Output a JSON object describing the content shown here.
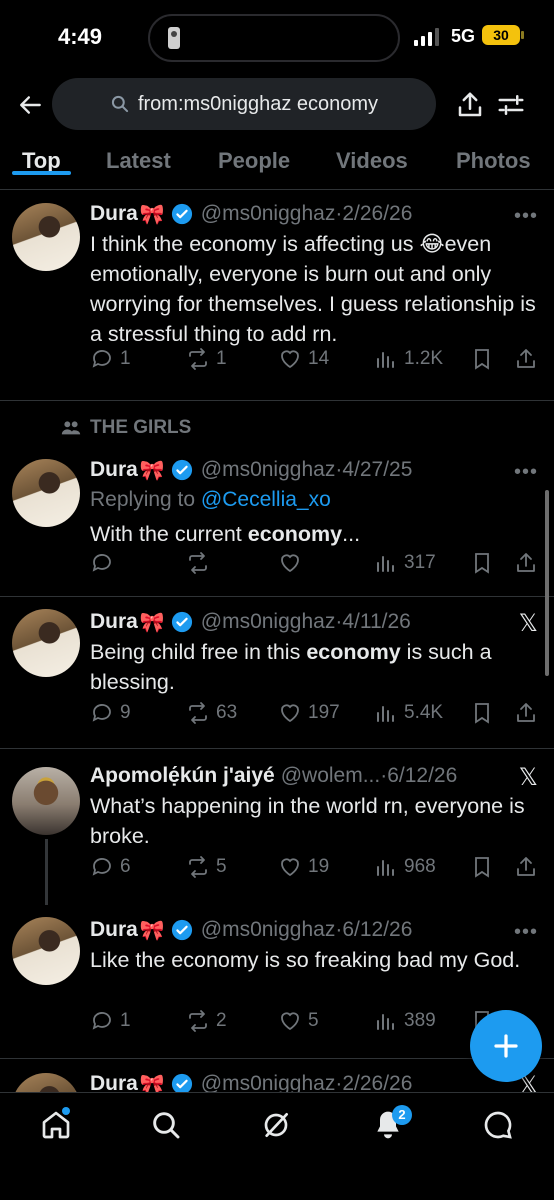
{
  "status_bar": {
    "time": "4:49",
    "network": "5G",
    "battery": "30"
  },
  "search": {
    "query": "from:ms0nigghaz economy"
  },
  "tabs": [
    {
      "label": "Top"
    },
    {
      "label": "Latest"
    },
    {
      "label": "People"
    },
    {
      "label": "Videos"
    },
    {
      "label": "Photos"
    }
  ],
  "colors": {
    "accent": "#1d9bf0",
    "muted": "#71767b",
    "background": "#000000"
  },
  "posts": [
    {
      "name": "Dura",
      "emoji": "🎀",
      "handle": "@ms0nigghaz",
      "date": "·2/26/26",
      "text_parts": [
        "I think the economy is affecting us 😂even emotionally, everyone is burn out and only worrying for themselves. I guess relationship is a stressful thing to add rn."
      ],
      "replies": "1",
      "reposts": "1",
      "likes": "14",
      "views": "1.2K"
    },
    {
      "social_context": "THE GIRLS",
      "name": "Dura",
      "emoji": "🎀",
      "handle": "@ms0nigghaz",
      "date": "·4/27/25",
      "replying_label": "Replying to ",
      "replying_to": "@Cecellia_xo",
      "text_parts": [
        "With the current ",
        "economy",
        "..."
      ],
      "replies": "",
      "reposts": "",
      "likes": "",
      "views": "317"
    },
    {
      "name": "Dura",
      "emoji": "🎀",
      "handle": "@ms0nigghaz",
      "date": "·4/11/26",
      "text_parts": [
        "Being child free in this ",
        "economy",
        " is such  a blessing."
      ],
      "replies": "9",
      "reposts": "63",
      "likes": "197",
      "views": "5.4K"
    },
    {
      "name": "Apomolẹ́kún j'aiyé",
      "handle": "@wolem...",
      "date": "·6/12/26",
      "text_parts": [
        "What’s happening in the world rn, everyone is broke."
      ],
      "replies": "6",
      "reposts": "5",
      "likes": "19",
      "views": "968"
    },
    {
      "name": "Dura",
      "emoji": "🎀",
      "handle": "@ms0nigghaz",
      "date": "·6/12/26",
      "text_parts": [
        "Like the economy is so freaking bad my God."
      ],
      "replies": "1",
      "reposts": "2",
      "likes": "5",
      "views": "389"
    },
    {
      "name": "Dura",
      "emoji": "🎀",
      "handle": "@ms0nigghaz",
      "date": "·2/26/26"
    }
  ],
  "bottom_nav": {
    "notifications_badge": "2"
  }
}
